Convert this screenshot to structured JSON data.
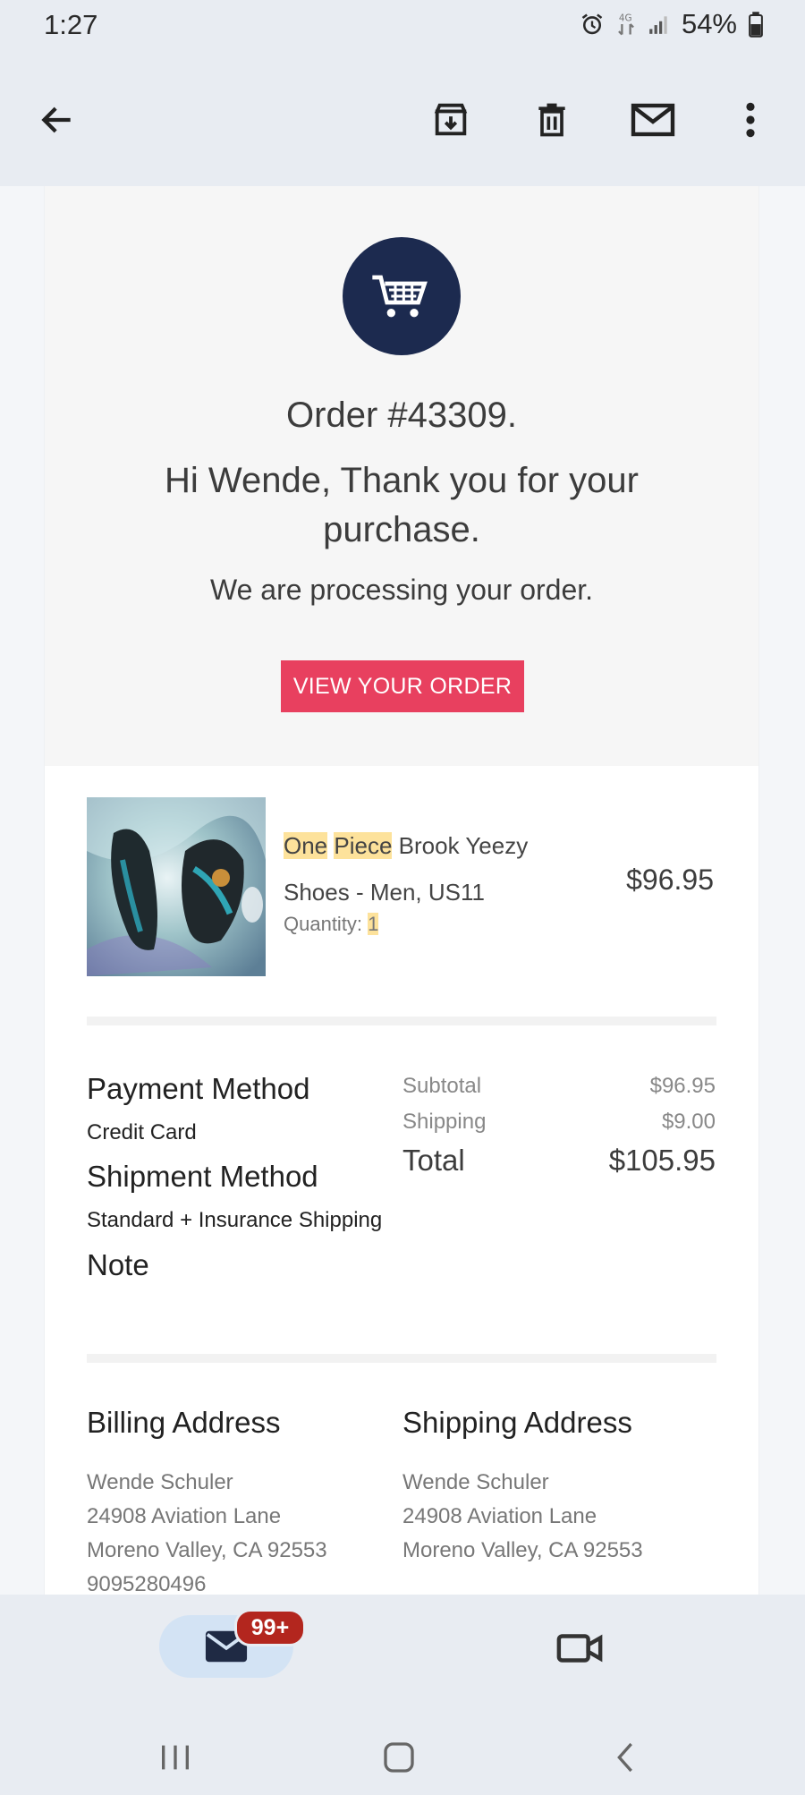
{
  "status_bar": {
    "time": "1:27",
    "battery": "54%"
  },
  "app_bar": {
    "icons": [
      "arrow-back-icon",
      "archive-icon",
      "delete-icon",
      "mark-unread-icon",
      "more-vert-icon"
    ]
  },
  "hero": {
    "order_number": "Order #43309.",
    "greeting": "Hi Wende, Thank you for your purchase.",
    "processing": "We are processing your order.",
    "view_order_label": "VIEW YOUR ORDER",
    "accent_color": "#e8405f",
    "badge_color": "#1c2a4f"
  },
  "product": {
    "name_highlight_1": "One",
    "name_highlight_2": "Piece",
    "name_rest": " Brook Yeezy Shoes - Men, US11",
    "quantity_label": "Quantity:",
    "quantity_value": "1",
    "price": "$96.95"
  },
  "details": {
    "payment_method_label": "Payment Method",
    "payment_method_value": "Credit Card",
    "shipment_method_label": "Shipment Method",
    "shipment_method_value": "Standard + Insurance Shipping",
    "note_label": "Note"
  },
  "summary": {
    "subtotal_label": "Subtotal",
    "subtotal_value": "$96.95",
    "shipping_label": "Shipping",
    "shipping_value": "$9.00",
    "total_label": "Total",
    "total_value": "$105.95"
  },
  "billing": {
    "heading": "Billing Address",
    "name": "Wende Schuler",
    "street": "24908 Aviation Lane",
    "city": "Moreno Valley, CA 92553",
    "phone": "9095280496"
  },
  "shipping": {
    "heading": "Shipping Address",
    "name": "Wende Schuler",
    "street": "24908 Aviation Lane",
    "city": "Moreno Valley, CA 92553"
  },
  "bottom_nav": {
    "mail_badge": "99+"
  }
}
